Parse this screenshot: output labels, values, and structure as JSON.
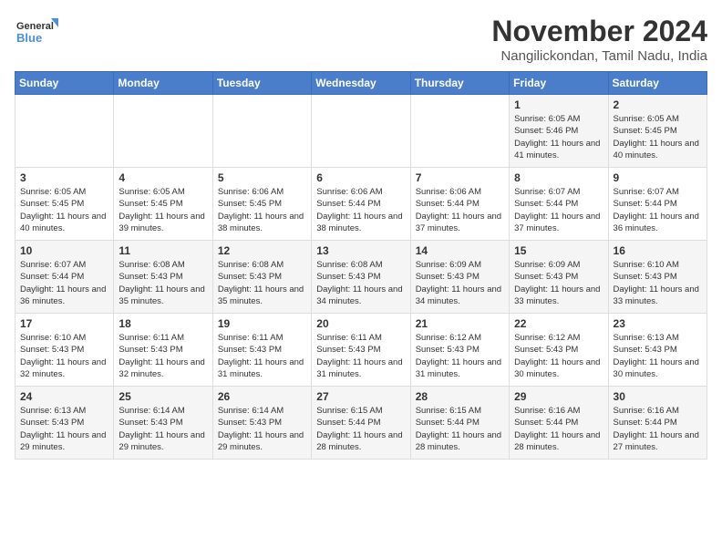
{
  "logo": {
    "line1": "General",
    "line2": "Blue"
  },
  "title": "November 2024",
  "location": "Nangilickondan, Tamil Nadu, India",
  "weekdays": [
    "Sunday",
    "Monday",
    "Tuesday",
    "Wednesday",
    "Thursday",
    "Friday",
    "Saturday"
  ],
  "weeks": [
    [
      {
        "day": "",
        "info": ""
      },
      {
        "day": "",
        "info": ""
      },
      {
        "day": "",
        "info": ""
      },
      {
        "day": "",
        "info": ""
      },
      {
        "day": "",
        "info": ""
      },
      {
        "day": "1",
        "info": "Sunrise: 6:05 AM\nSunset: 5:46 PM\nDaylight: 11 hours and 41 minutes."
      },
      {
        "day": "2",
        "info": "Sunrise: 6:05 AM\nSunset: 5:45 PM\nDaylight: 11 hours and 40 minutes."
      }
    ],
    [
      {
        "day": "3",
        "info": "Sunrise: 6:05 AM\nSunset: 5:45 PM\nDaylight: 11 hours and 40 minutes."
      },
      {
        "day": "4",
        "info": "Sunrise: 6:05 AM\nSunset: 5:45 PM\nDaylight: 11 hours and 39 minutes."
      },
      {
        "day": "5",
        "info": "Sunrise: 6:06 AM\nSunset: 5:45 PM\nDaylight: 11 hours and 38 minutes."
      },
      {
        "day": "6",
        "info": "Sunrise: 6:06 AM\nSunset: 5:44 PM\nDaylight: 11 hours and 38 minutes."
      },
      {
        "day": "7",
        "info": "Sunrise: 6:06 AM\nSunset: 5:44 PM\nDaylight: 11 hours and 37 minutes."
      },
      {
        "day": "8",
        "info": "Sunrise: 6:07 AM\nSunset: 5:44 PM\nDaylight: 11 hours and 37 minutes."
      },
      {
        "day": "9",
        "info": "Sunrise: 6:07 AM\nSunset: 5:44 PM\nDaylight: 11 hours and 36 minutes."
      }
    ],
    [
      {
        "day": "10",
        "info": "Sunrise: 6:07 AM\nSunset: 5:44 PM\nDaylight: 11 hours and 36 minutes."
      },
      {
        "day": "11",
        "info": "Sunrise: 6:08 AM\nSunset: 5:43 PM\nDaylight: 11 hours and 35 minutes."
      },
      {
        "day": "12",
        "info": "Sunrise: 6:08 AM\nSunset: 5:43 PM\nDaylight: 11 hours and 35 minutes."
      },
      {
        "day": "13",
        "info": "Sunrise: 6:08 AM\nSunset: 5:43 PM\nDaylight: 11 hours and 34 minutes."
      },
      {
        "day": "14",
        "info": "Sunrise: 6:09 AM\nSunset: 5:43 PM\nDaylight: 11 hours and 34 minutes."
      },
      {
        "day": "15",
        "info": "Sunrise: 6:09 AM\nSunset: 5:43 PM\nDaylight: 11 hours and 33 minutes."
      },
      {
        "day": "16",
        "info": "Sunrise: 6:10 AM\nSunset: 5:43 PM\nDaylight: 11 hours and 33 minutes."
      }
    ],
    [
      {
        "day": "17",
        "info": "Sunrise: 6:10 AM\nSunset: 5:43 PM\nDaylight: 11 hours and 32 minutes."
      },
      {
        "day": "18",
        "info": "Sunrise: 6:11 AM\nSunset: 5:43 PM\nDaylight: 11 hours and 32 minutes."
      },
      {
        "day": "19",
        "info": "Sunrise: 6:11 AM\nSunset: 5:43 PM\nDaylight: 11 hours and 31 minutes."
      },
      {
        "day": "20",
        "info": "Sunrise: 6:11 AM\nSunset: 5:43 PM\nDaylight: 11 hours and 31 minutes."
      },
      {
        "day": "21",
        "info": "Sunrise: 6:12 AM\nSunset: 5:43 PM\nDaylight: 11 hours and 31 minutes."
      },
      {
        "day": "22",
        "info": "Sunrise: 6:12 AM\nSunset: 5:43 PM\nDaylight: 11 hours and 30 minutes."
      },
      {
        "day": "23",
        "info": "Sunrise: 6:13 AM\nSunset: 5:43 PM\nDaylight: 11 hours and 30 minutes."
      }
    ],
    [
      {
        "day": "24",
        "info": "Sunrise: 6:13 AM\nSunset: 5:43 PM\nDaylight: 11 hours and 29 minutes."
      },
      {
        "day": "25",
        "info": "Sunrise: 6:14 AM\nSunset: 5:43 PM\nDaylight: 11 hours and 29 minutes."
      },
      {
        "day": "26",
        "info": "Sunrise: 6:14 AM\nSunset: 5:43 PM\nDaylight: 11 hours and 29 minutes."
      },
      {
        "day": "27",
        "info": "Sunrise: 6:15 AM\nSunset: 5:44 PM\nDaylight: 11 hours and 28 minutes."
      },
      {
        "day": "28",
        "info": "Sunrise: 6:15 AM\nSunset: 5:44 PM\nDaylight: 11 hours and 28 minutes."
      },
      {
        "day": "29",
        "info": "Sunrise: 6:16 AM\nSunset: 5:44 PM\nDaylight: 11 hours and 28 minutes."
      },
      {
        "day": "30",
        "info": "Sunrise: 6:16 AM\nSunset: 5:44 PM\nDaylight: 11 hours and 27 minutes."
      }
    ]
  ]
}
